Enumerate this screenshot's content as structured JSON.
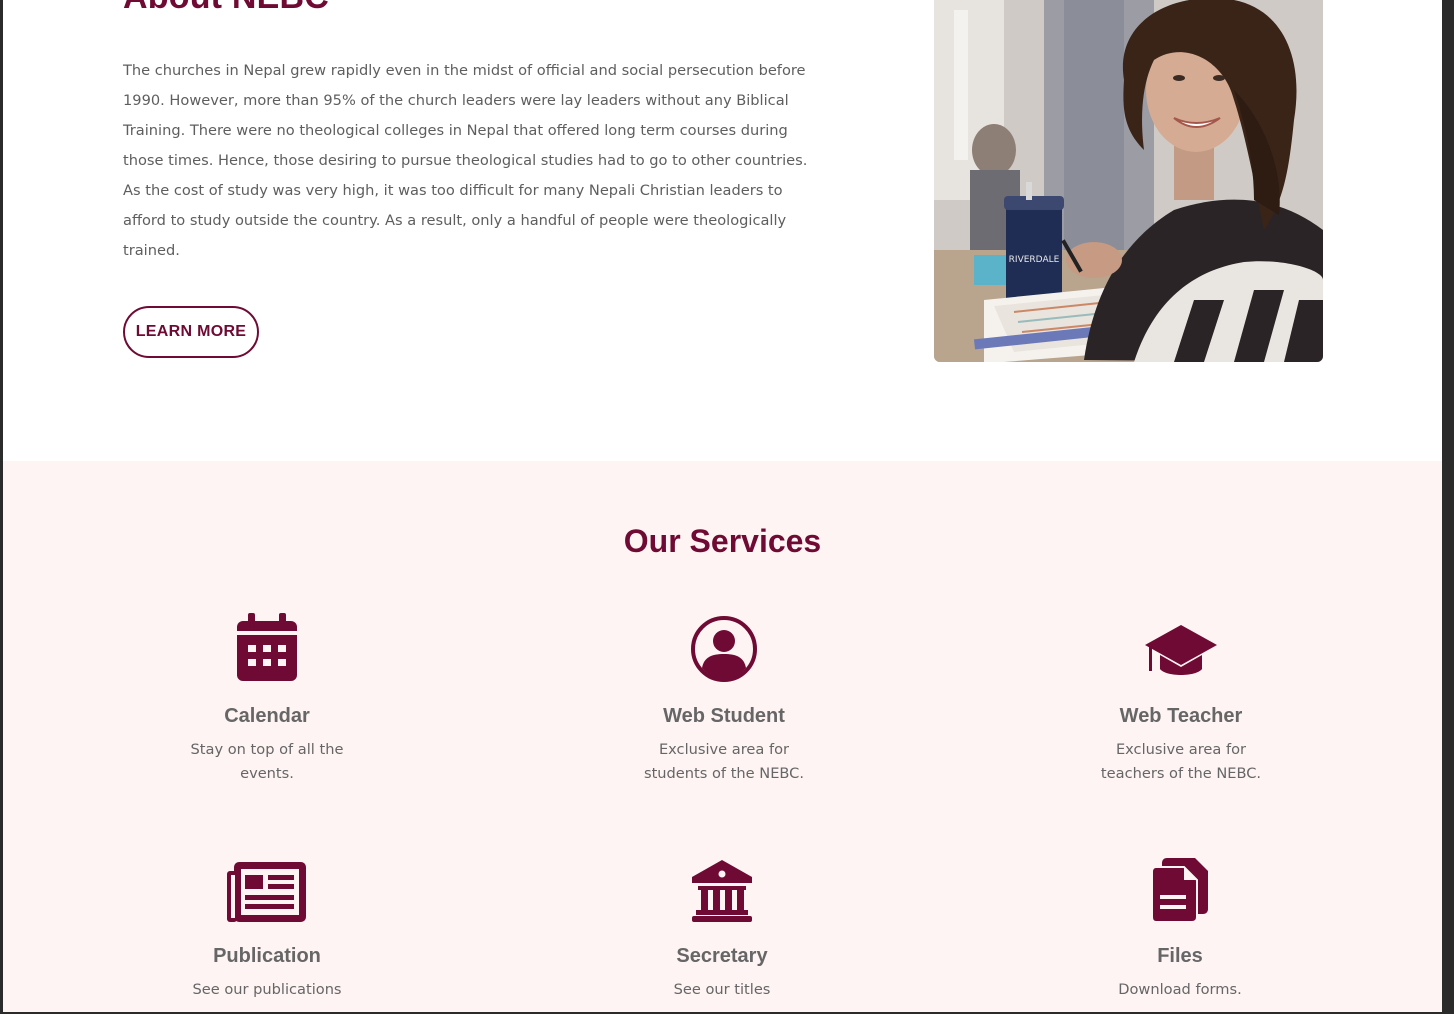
{
  "about": {
    "title": "About NEBC",
    "paragraph": "The churches in Nepal grew rapidly even in the midst of official and social persecution before 1990. However, more than 95% of the church leaders were lay leaders without any Biblical Training. There were no theological colleges in Nepal that offered long term courses during those times. Hence, those desiring to pursue theological studies had to go to other countries. As the cost of study was very high, it was too difficult for many Nepali Christian leaders to afford to study outside the country. As a result, only a handful of people were theologically trained.",
    "button_label": "LEARN MORE"
  },
  "services": {
    "title": "Our Services",
    "items": [
      {
        "icon": "calendar-icon",
        "name": "Calendar",
        "desc": "Stay on top of all the events."
      },
      {
        "icon": "user-circle-icon",
        "name": "Web Student",
        "desc": "Exclusive area for students of the NEBC."
      },
      {
        "icon": "graduation-cap-icon",
        "name": "Web Teacher",
        "desc": "Exclusive area for teachers of the NEBC."
      },
      {
        "icon": "newspaper-icon",
        "name": "Publication",
        "desc": "See our publications"
      },
      {
        "icon": "landmark-icon",
        "name": "Secretary",
        "desc": "See our titles"
      },
      {
        "icon": "files-icon",
        "name": "Files",
        "desc": "Download forms."
      }
    ]
  },
  "colors": {
    "brand": "#6e0a33",
    "services_bg": "#fdf4f3",
    "text": "#5e5e5e"
  }
}
